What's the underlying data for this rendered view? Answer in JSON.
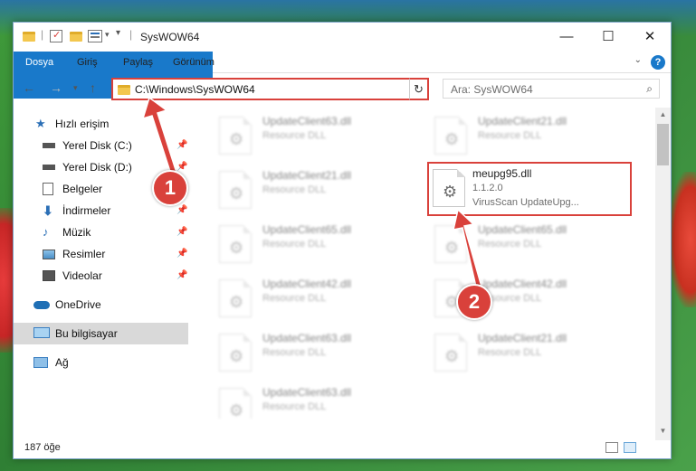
{
  "window": {
    "title": "SysWOW64"
  },
  "ribbon": {
    "tabs": [
      "Dosya",
      "Giriş",
      "Paylaş",
      "Görünüm"
    ]
  },
  "address": {
    "path": "C:\\Windows\\SysWOW64"
  },
  "search": {
    "placeholder": "Ara: SysWOW64"
  },
  "sidebar": {
    "items": [
      {
        "label": "Hızlı erişim",
        "icon": "star-icon"
      },
      {
        "label": "Yerel Disk (C:)",
        "icon": "drive-icon"
      },
      {
        "label": "Yerel Disk (D:)",
        "icon": "drive-icon"
      },
      {
        "label": "Belgeler",
        "icon": "documents-icon"
      },
      {
        "label": "İndirmeler",
        "icon": "download-icon"
      },
      {
        "label": "Müzik",
        "icon": "music-icon"
      },
      {
        "label": "Resimler",
        "icon": "pictures-icon"
      },
      {
        "label": "Videolar",
        "icon": "videos-icon"
      },
      {
        "label": "OneDrive",
        "icon": "cloud-icon"
      },
      {
        "label": "Bu bilgisayar",
        "icon": "computer-icon"
      },
      {
        "label": "Ağ",
        "icon": "network-icon"
      }
    ]
  },
  "files": {
    "left": [
      {
        "name": "UpdateClient63.dll",
        "desc": "Resource DLL"
      },
      {
        "name": "UpdateClient21.dll",
        "desc": "Resource DLL"
      },
      {
        "name": "UpdateClient65.dll",
        "desc": "Resource DLL"
      },
      {
        "name": "UpdateClient42.dll",
        "desc": "Resource DLL"
      },
      {
        "name": "UpdateClient63.dll",
        "desc": "Resource DLL"
      },
      {
        "name": "UpdateClient63.dll",
        "desc": "Resource DLL"
      }
    ],
    "right": [
      {
        "name": "UpdateClient21.dll",
        "desc": "Resource DLL"
      },
      {
        "name": "UpdateClient65.dll",
        "desc": "Resource DLL"
      },
      {
        "name": "UpdateClient42.dll",
        "desc": "Resource DLL"
      },
      {
        "name": "UpdateClient21.dll",
        "desc": "Resource DLL"
      }
    ],
    "highlighted": {
      "name": "meupg95.dll",
      "version": "1.1.2.0",
      "desc": "VirusScan UpdateUpg..."
    }
  },
  "status": {
    "count": "187 öğe"
  },
  "annotations": {
    "step1": "1",
    "step2": "2",
    "color": "#d9413b"
  }
}
